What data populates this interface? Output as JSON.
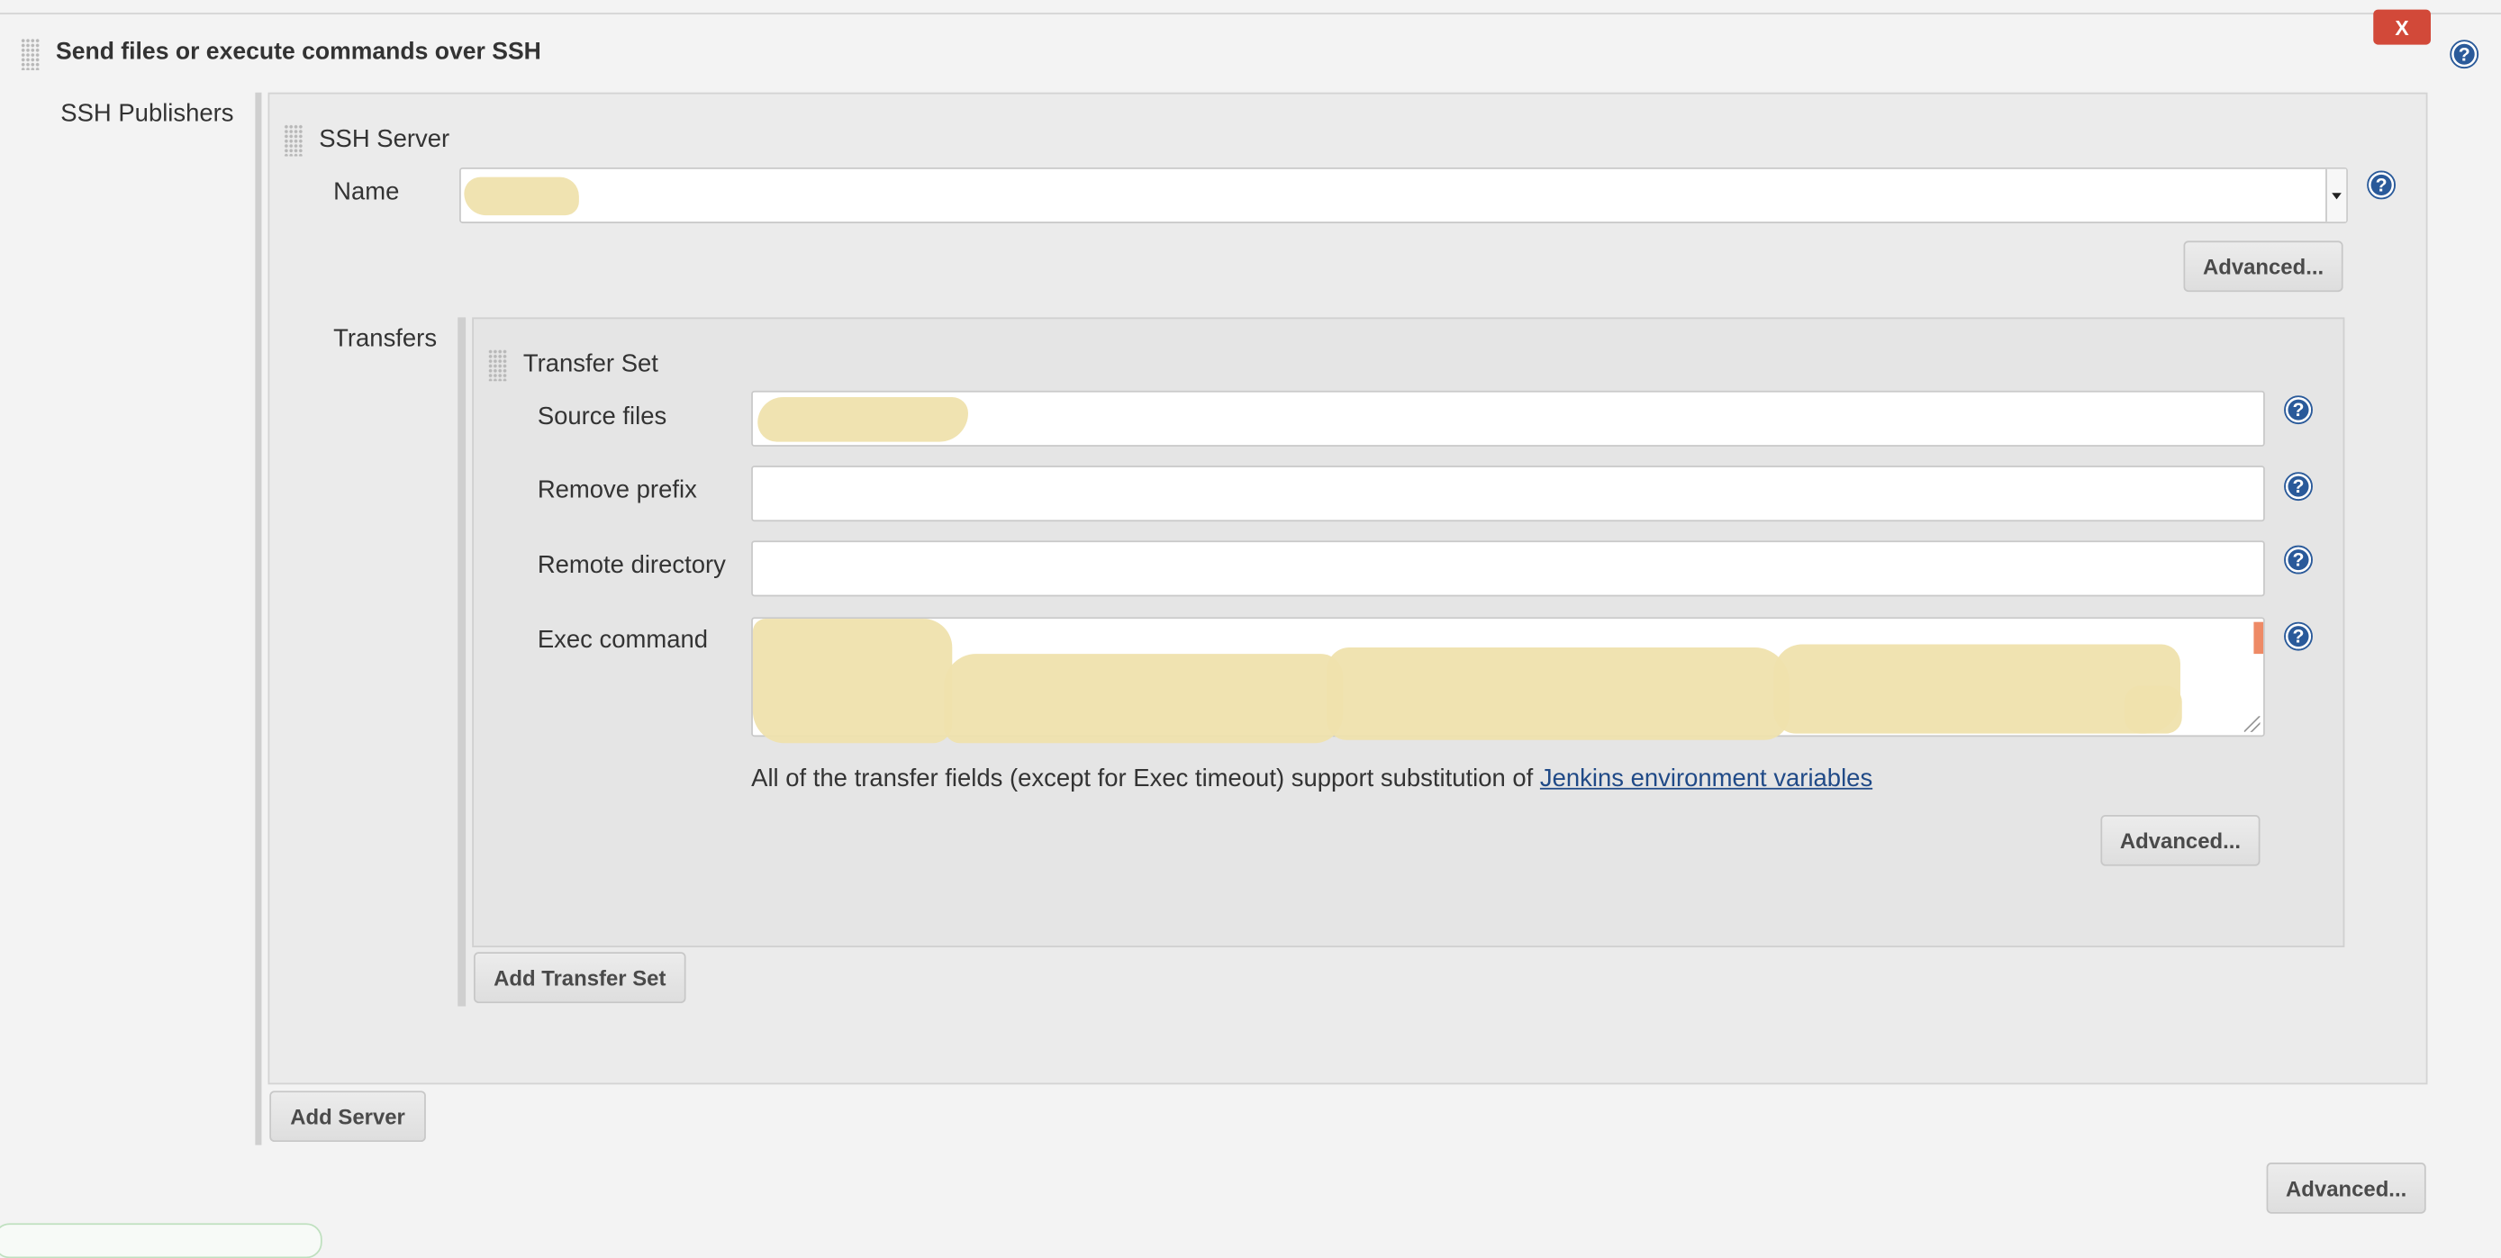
{
  "section": {
    "title": "Send files or execute commands over SSH",
    "close_label": "X"
  },
  "publishers": {
    "label": "SSH Publishers",
    "server": {
      "header": "SSH Server",
      "name_label": "Name",
      "name_value": "",
      "advanced_label": "Advanced...",
      "transfers_label": "Transfers",
      "transfer_set": {
        "header": "Transfer Set",
        "source_files_label": "Source files",
        "source_files_value": "",
        "remove_prefix_label": "Remove prefix",
        "remove_prefix_value": "",
        "remote_directory_label": "Remote directory",
        "remote_directory_value": "",
        "exec_command_label": "Exec command",
        "exec_command_value": "",
        "note_text": "All of the transfer fields (except for Exec timeout) support substitution of ",
        "note_link": "Jenkins environment variables",
        "advanced_label": "Advanced..."
      },
      "add_transfer_set_label": "Add Transfer Set"
    },
    "add_server_label": "Add Server"
  },
  "bottom_advanced_label": "Advanced...",
  "help_icon_glyph": "?",
  "colors": {
    "background": "#f3f3f3",
    "close_button": "#d24939",
    "help_icon": "#2a5a9a",
    "link": "#204a87"
  }
}
